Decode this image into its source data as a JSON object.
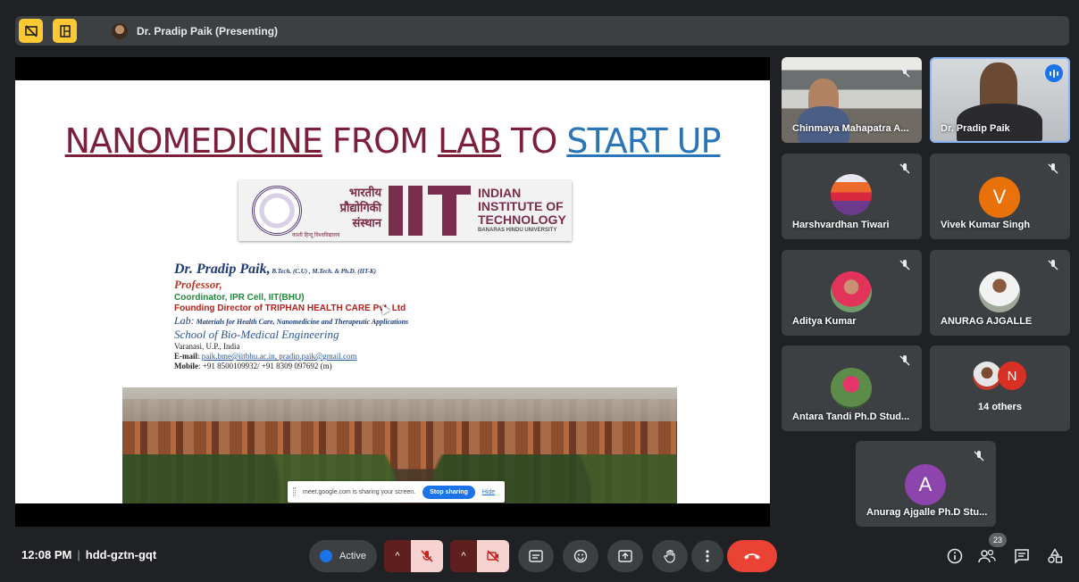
{
  "topbar": {
    "presenter_label": "Dr. Pradip Paik (Presenting)",
    "icons": [
      "present-off-icon",
      "layout-icon"
    ]
  },
  "slide": {
    "title_part1": "NANOMEDICINE",
    "title_part2": " FROM ",
    "title_part3": "LAB",
    "title_part4": " TO ",
    "title_part5": "START UP",
    "logo_hindi_line1": "भारतीय",
    "logo_hindi_line2": "प्रौद्योगिकी",
    "logo_hindi_line3": "संस्थान",
    "logo_hindi_sub": "काशी हिन्दू विश्वविद्यालय",
    "logo_en_line1": "INDIAN",
    "logo_en_line2": "INSTITUTE OF",
    "logo_en_line3": "TECHNOLOGY",
    "logo_en_sub": "BANARAS HINDU UNIVERSITY",
    "name": "Dr. Pradip Paik,",
    "degrees": " B.Tech. (C.U) , M.Tech. & Ph.D. (IIT-K)",
    "role": "Professor,",
    "coordinator": "Coordinator, IPR Cell, IIT(BHU)",
    "founder": "Founding Director of TRIPHAN HEALTH CARE Pvt. Ltd",
    "lab_prefix": "Lab:",
    "lab_text": " Materials for Health Care, Nanomedicine and Therapeutic Applications",
    "school": "School of Bio-Medical Engineering",
    "city": "Varanasi, U.P., India",
    "email_label": "E-mail",
    "email_value": "paik.bme@iitbhu.ac.in, pradip.paik@gmail.com",
    "mobile_label": "Mobile",
    "mobile_value": ": +91 8500109932/ +91 8309 097692 (m)"
  },
  "share_bar": {
    "message": "meet.google.com is sharing your screen.",
    "stop_label": "Stop sharing",
    "hide_label": "Hide"
  },
  "participants": {
    "tile1": "Chinmaya Mahapatra A...",
    "tile2": "Dr. Pradip Paik",
    "tile3": "Harshvardhan Tiwari",
    "tile4": "Vivek Kumar Singh",
    "tile4_initial": "V",
    "tile5": "Aditya Kumar",
    "tile6": "ANURAG AJGALLE",
    "tile7": "Antara Tandi Ph.D Stud...",
    "tile8_others": "14 others",
    "tile8_initial": "N",
    "tile9": "Anurag Ajgalle Ph.D Stu...",
    "tile9_initial": "A"
  },
  "bottombar": {
    "time": "12:08 PM",
    "separator": "|",
    "meeting_code": "hdd-gztn-gqt",
    "active_label": "Active",
    "people_count": "23"
  },
  "colors": {
    "background": "#202124",
    "tile": "#3c4043",
    "end_call": "#ea4335",
    "accent": "#1a73e8",
    "avatar_vivek": "#e8710a",
    "avatar_anurag": "#8e44ad",
    "avatar_n": "#d93025"
  }
}
